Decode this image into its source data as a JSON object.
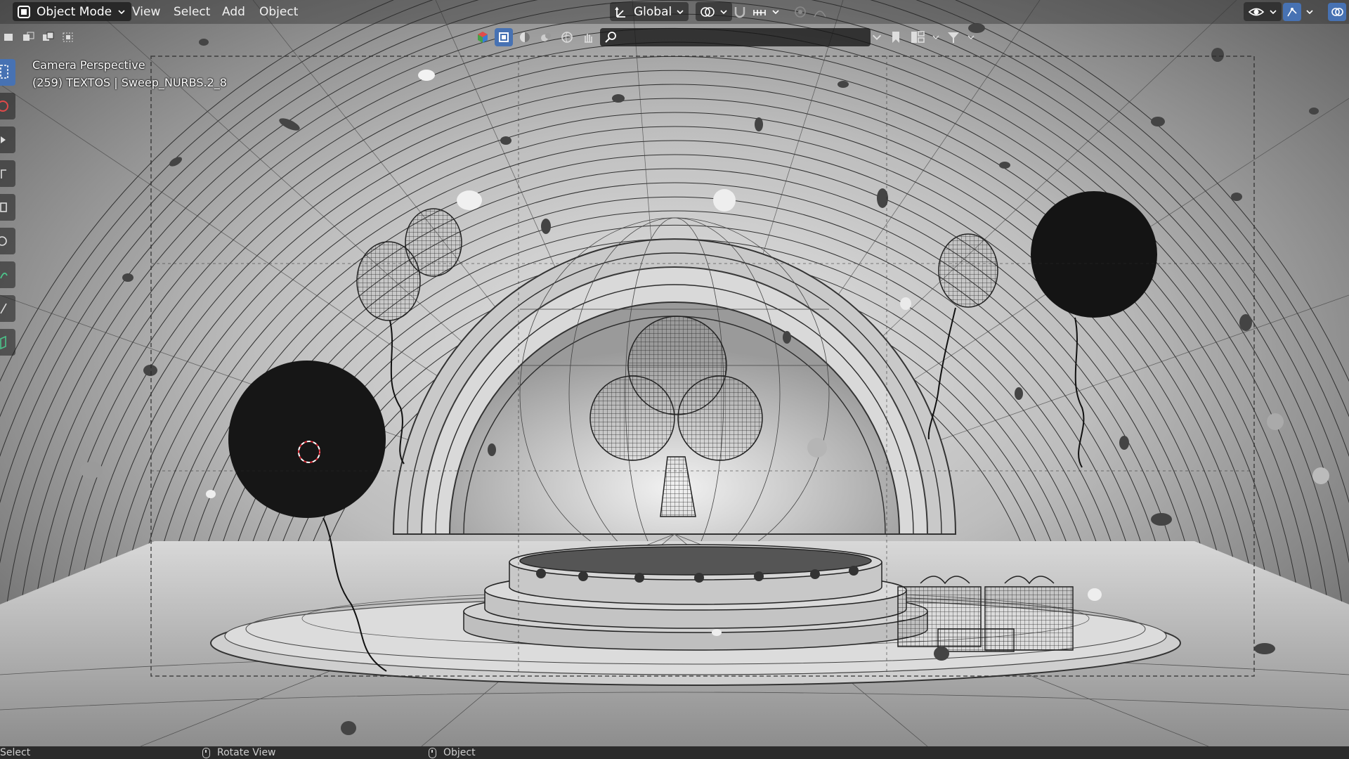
{
  "header": {
    "mode": "Object Mode",
    "menus": [
      "View",
      "Select",
      "Add",
      "Object"
    ],
    "transform_orientation": "Global"
  },
  "toolbar": {
    "search_placeholder": "",
    "search_value": ""
  },
  "viewport": {
    "view_name": "Camera Perspective",
    "object_info": "(259) TEXTOS | Sweep_NURBS.2_8"
  },
  "statusbar": {
    "left": "Select",
    "middle": "Rotate View",
    "right": "Object"
  },
  "colors": {
    "accent": "#4772b3",
    "header_bg": "#282828",
    "statusbar_bg": "#2b2b2b"
  },
  "icons": {
    "mode": "object-mode-icon",
    "orientation": "transform-orientation-icon",
    "search": "search-icon",
    "filter": "filter-icon",
    "visibility": "eye-icon",
    "gizmo": "gizmo-icon"
  }
}
